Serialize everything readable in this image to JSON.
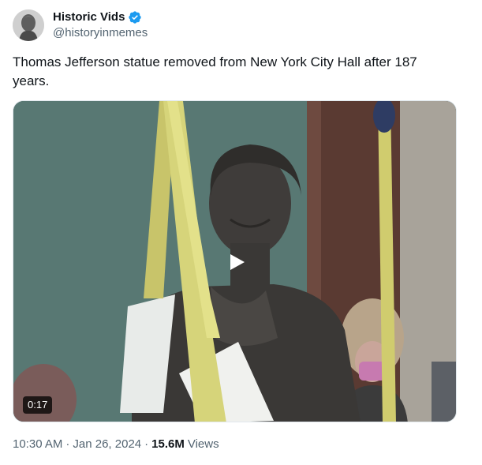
{
  "author": {
    "display_name": "Historic Vids",
    "handle": "@historyinmemes",
    "verified": true,
    "verified_color": "#1d9bf0"
  },
  "tweet": {
    "text": "Thomas Jefferson statue removed from New York City Hall after 187 years."
  },
  "media": {
    "type": "video",
    "duration": "0:17",
    "play_icon": "play-icon"
  },
  "meta": {
    "time": "10:30 AM",
    "separator": "·",
    "date": "Jan 26, 2024",
    "views_count": "15.6M",
    "views_label": "Views"
  }
}
